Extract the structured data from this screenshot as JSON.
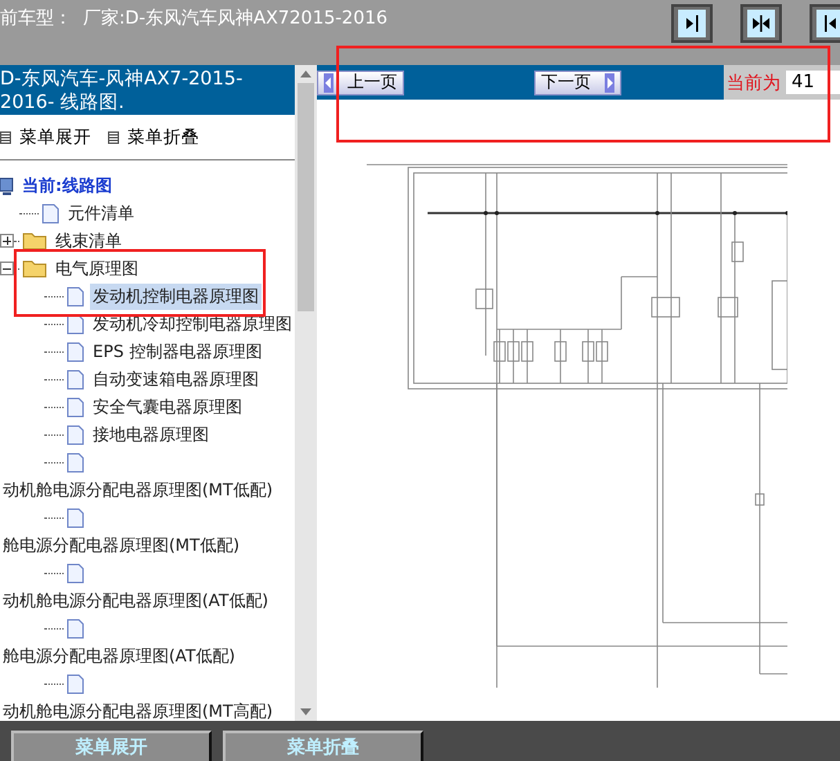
{
  "header": {
    "vehicle_label": "前车型：",
    "vehicle_value": "厂家:D-东风汽车风神AX72015-2016"
  },
  "toolbar_buttons": [
    {
      "kind": "right"
    },
    {
      "kind": "both"
    },
    {
      "kind": "left"
    }
  ],
  "sidebar": {
    "title": "D-东风汽车-风神AX7-2015-2016- 线路图.",
    "menu_actions": [
      "菜单展开",
      "菜单折叠"
    ],
    "tree": {
      "label": "当前:线路图",
      "children": [
        {
          "kind": "doc",
          "label": "元件清单",
          "selected": false
        },
        {
          "kind": "folder",
          "label": "线束清单",
          "expanded": false,
          "selected": false
        },
        {
          "kind": "folder",
          "label": "电气原理图",
          "expanded": true,
          "selected": false,
          "children": [
            {
              "kind": "doc",
              "label": "发动机控制电器原理图",
              "selected": true
            },
            {
              "kind": "doc",
              "label": "发动机冷却控制电器原理图",
              "selected": false
            },
            {
              "kind": "doc",
              "label": "EPS 控制器电器原理图",
              "selected": false
            },
            {
              "kind": "doc",
              "label": "自动变速箱电器原理图",
              "selected": false
            },
            {
              "kind": "doc",
              "label": "安全气囊电器原理图",
              "selected": false
            },
            {
              "kind": "doc",
              "label": "接地电器原理图",
              "selected": false
            },
            {
              "kind": "doc-wrap",
              "label": "动机舱电源分配电器原理图(MT低配)",
              "selected": false
            },
            {
              "kind": "doc-wrap",
              "label": "舱电源分配电器原理图(MT低配)",
              "selected": false
            },
            {
              "kind": "doc-wrap",
              "label": "动机舱电源分配电器原理图(AT低配)",
              "selected": false
            },
            {
              "kind": "doc-wrap",
              "label": "舱电源分配电器原理图(AT低配)",
              "selected": false
            },
            {
              "kind": "doc-wrap",
              "label": "动机舱电源分配电器原理图(MT高配)",
              "selected": false
            }
          ]
        }
      ]
    }
  },
  "pager": {
    "previous": "上一页",
    "next": "下一页",
    "page_label": "当前为",
    "page_value": "41"
  },
  "footer_buttons": [
    "菜单展开",
    "菜单折叠"
  ]
}
